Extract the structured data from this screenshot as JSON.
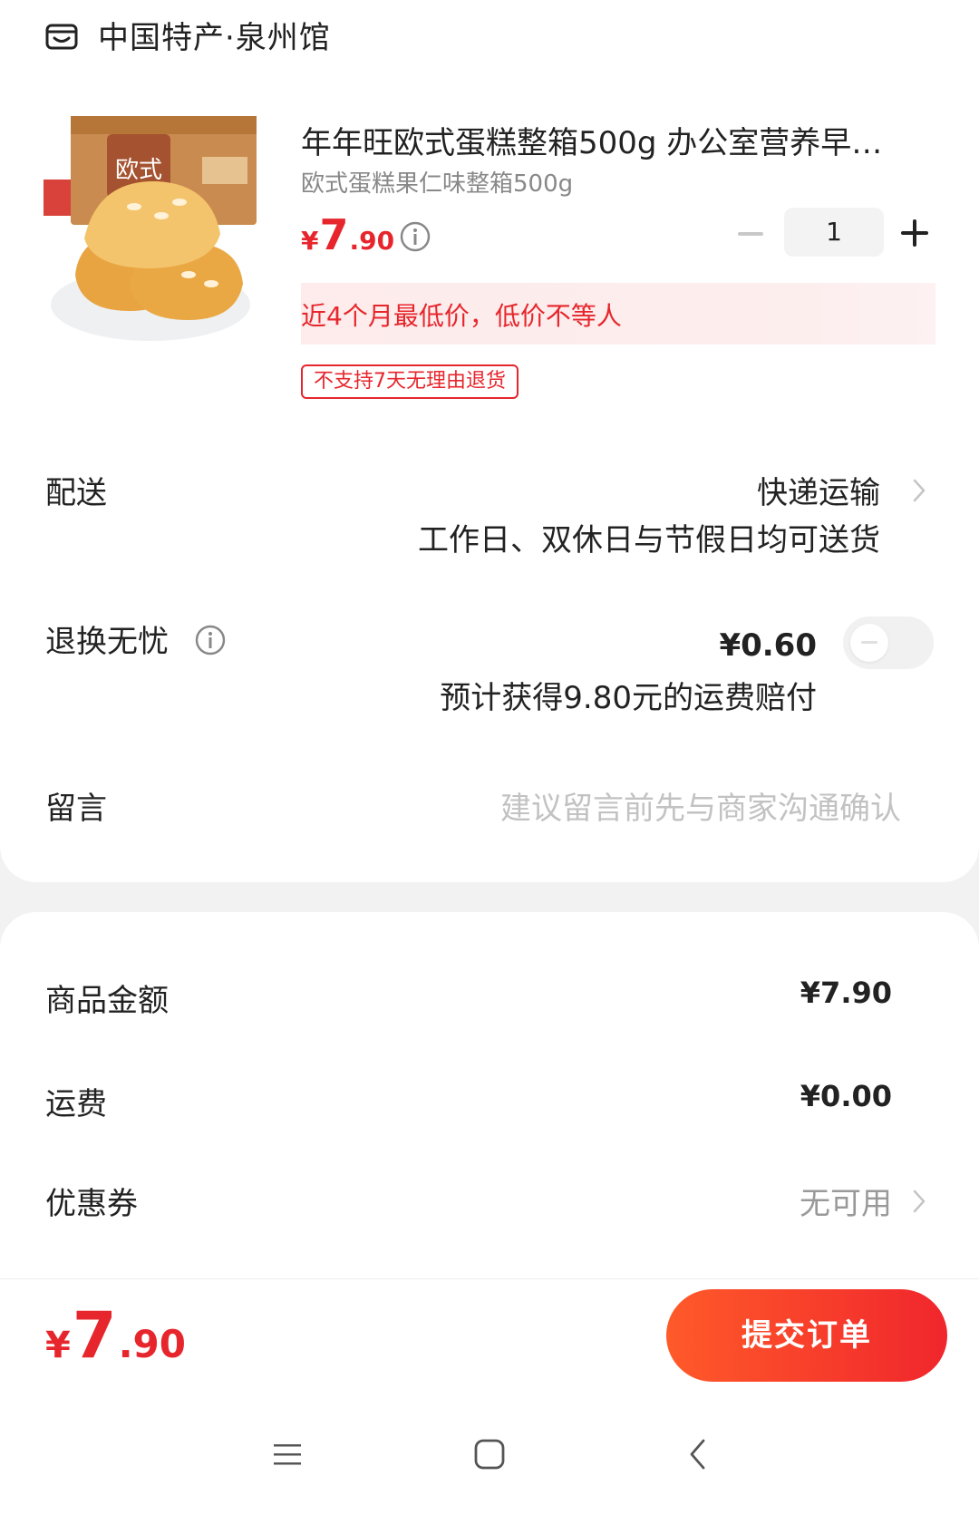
{
  "shop": {
    "name": "中国特产·泉州馆",
    "icon": "shop-icon"
  },
  "product": {
    "title": "年年旺欧式蛋糕整箱500g 办公室营养早…",
    "sku": "欧式蛋糕果仁味整箱500g",
    "price": {
      "symbol": "¥",
      "integer": "7",
      "decimal": ".90"
    },
    "quantity": "1",
    "promo": "近4个月最低价，低价不等人",
    "return_tag": "不支持7天无理由退货"
  },
  "delivery": {
    "label": "配送",
    "method": "快递运输",
    "note": "工作日、双休日与节假日均可送货"
  },
  "return_insurance": {
    "label": "退换无忧",
    "price": "¥0.60",
    "note": "预计获得9.80元的运费赔付",
    "enabled": false
  },
  "message": {
    "label": "留言",
    "placeholder": "建议留言前先与商家沟通确认"
  },
  "summary": {
    "goods_label": "商品金额",
    "goods_value": "¥7.90",
    "shipping_label": "运费",
    "shipping_value": "¥0.00",
    "coupon_label": "优惠券",
    "coupon_value": "无可用"
  },
  "footer": {
    "total": {
      "symbol": "¥",
      "integer": "7",
      "decimal": ".90"
    },
    "submit_label": "提交订单"
  },
  "colors": {
    "accent": "#e6262c",
    "button_start": "#ff5a2a",
    "button_end": "#f0262c"
  }
}
